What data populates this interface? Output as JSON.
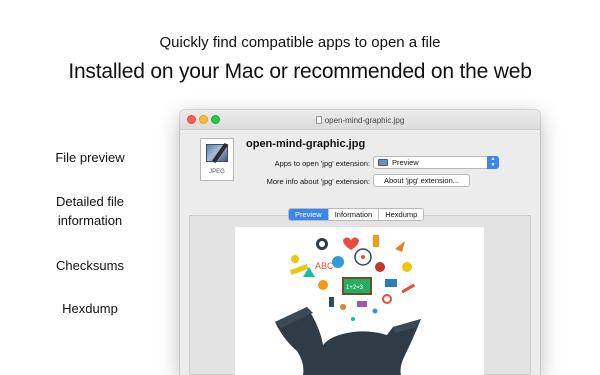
{
  "headline": {
    "sub": "Quickly find compatible apps to open a file",
    "main": "Installed on your Mac or recommended on the web"
  },
  "features": [
    {
      "label": "File preview"
    },
    {
      "label": "Detailed file information"
    },
    {
      "label": "Checksums"
    },
    {
      "label": "Hexdump"
    }
  ],
  "window": {
    "title": "open-mind-graphic.jpg",
    "file_name": "open-mind-graphic.jpg",
    "file_icon_ext": "JPEG",
    "apps_label": "Apps to open 'jpg' extension:",
    "apps_selected": "Preview",
    "info_label": "More info about 'jpg' extension:",
    "about_button": "About 'jpg' extension...",
    "tabs": [
      {
        "label": "Preview",
        "active": true
      },
      {
        "label": "Information",
        "active": false
      },
      {
        "label": "Hexdump",
        "active": false
      }
    ]
  },
  "preview_image": {
    "text_abc": "ABC",
    "text_formula": "1+2=3"
  },
  "colors": {
    "accent": "#3a86f0",
    "close": "#fc5f57",
    "minimize": "#fdbc2e",
    "maximize": "#29c940",
    "head": "#2f3b46"
  }
}
